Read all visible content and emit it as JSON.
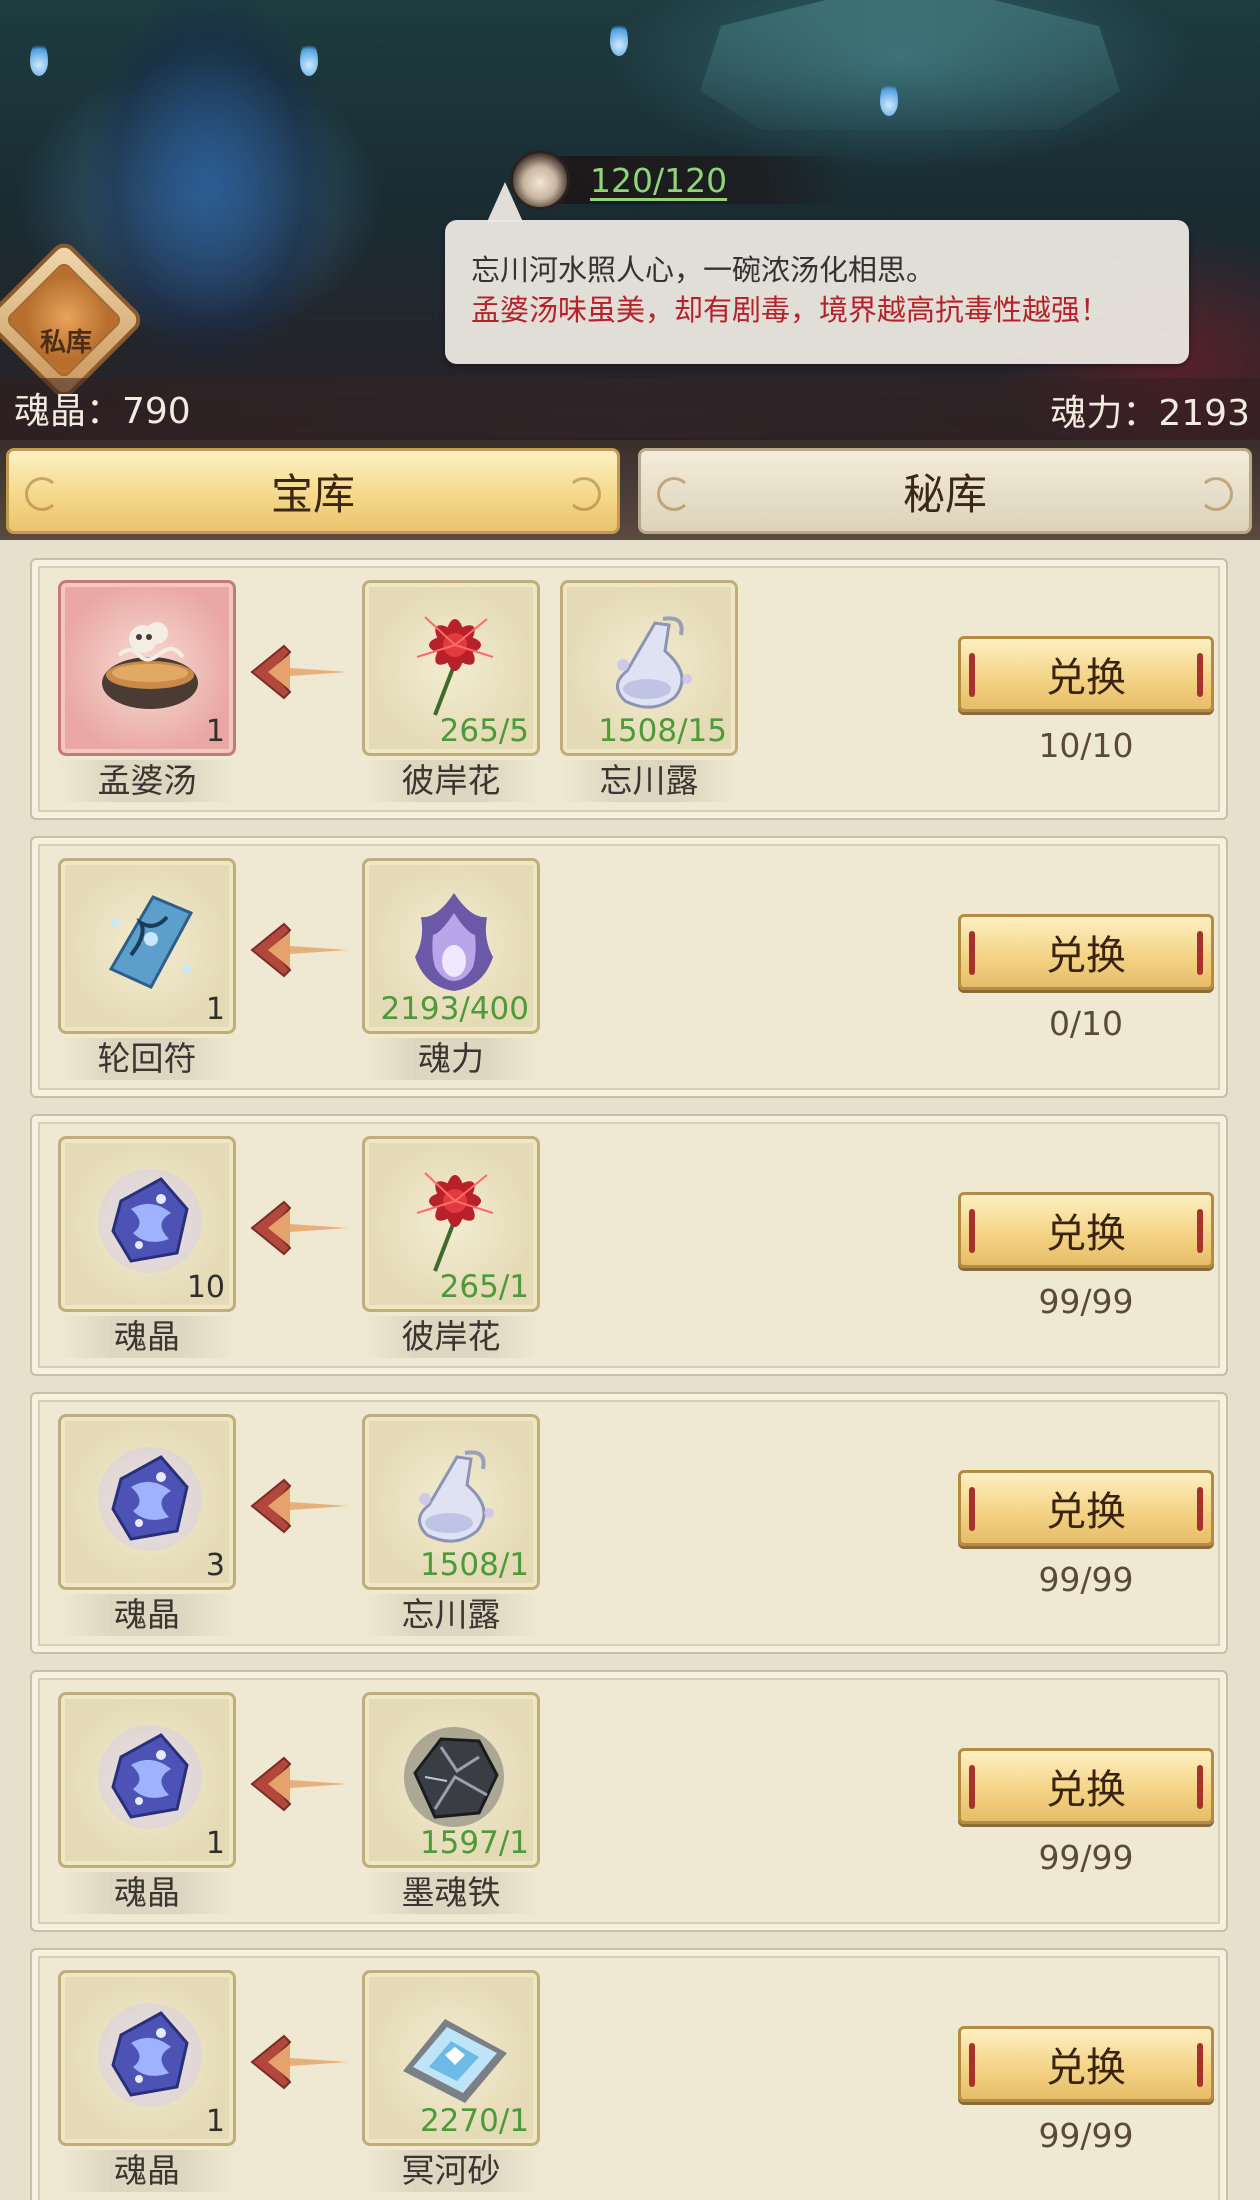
{
  "header": {
    "stamina": "120/120",
    "speech": {
      "line1": "忘川河水照人心，一碗浓汤化相思。",
      "line2": "孟婆汤味虽美，却有剧毒，境界越高抗毒性越强！"
    },
    "private_vault_label": "私库",
    "soul_crystal": "魂晶：790",
    "soul_power": "魂力：2193"
  },
  "tabs": [
    {
      "label": "宝库",
      "active": true
    },
    {
      "label": "秘库",
      "active": false
    }
  ],
  "exchange_label": "兑换",
  "rows": [
    {
      "output": {
        "name": "孟婆汤",
        "count": "1",
        "icon": "soup-bowl-icon"
      },
      "inputs": [
        {
          "name": "彼岸花",
          "req": "265/5",
          "icon": "red-spider-lily-icon"
        },
        {
          "name": "忘川露",
          "req": "1508/15",
          "icon": "dew-flask-icon"
        }
      ],
      "limit": "10/10"
    },
    {
      "output": {
        "name": "轮回符",
        "count": "1",
        "icon": "talisman-icon"
      },
      "inputs": [
        {
          "name": "魂力",
          "req": "2193/400",
          "icon": "soul-flame-icon"
        }
      ],
      "limit": "0/10"
    },
    {
      "output": {
        "name": "魂晶",
        "count": "10",
        "icon": "soul-crystal-icon"
      },
      "inputs": [
        {
          "name": "彼岸花",
          "req": "265/1",
          "icon": "red-spider-lily-icon"
        }
      ],
      "limit": "99/99"
    },
    {
      "output": {
        "name": "魂晶",
        "count": "3",
        "icon": "soul-crystal-icon"
      },
      "inputs": [
        {
          "name": "忘川露",
          "req": "1508/1",
          "icon": "dew-flask-icon"
        }
      ],
      "limit": "99/99"
    },
    {
      "output": {
        "name": "魂晶",
        "count": "1",
        "icon": "soul-crystal-icon"
      },
      "inputs": [
        {
          "name": "墨魂铁",
          "req": "1597/1",
          "icon": "ink-iron-ore-icon"
        }
      ],
      "limit": "99/99"
    },
    {
      "output": {
        "name": "魂晶",
        "count": "1",
        "icon": "soul-crystal-icon"
      },
      "inputs": [
        {
          "name": "冥河砂",
          "req": "2270/1",
          "icon": "styx-sand-icon"
        }
      ],
      "limit": "99/99"
    }
  ]
}
